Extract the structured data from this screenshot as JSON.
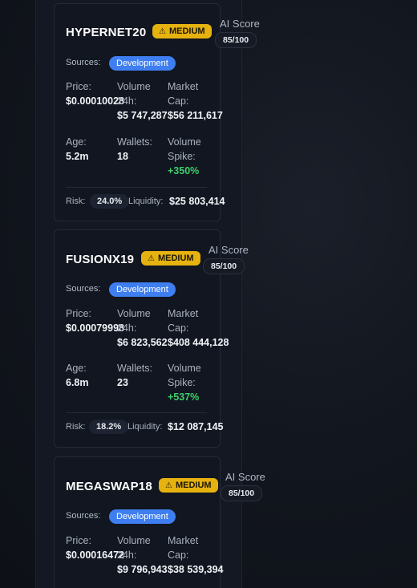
{
  "cards": [
    {
      "name": "HYPERNET20",
      "risk_level": "MEDIUM",
      "ai_label": "AI Score",
      "ai_score": "85/100",
      "sources_label": "Sources:",
      "source_tag": "Development",
      "price_label": "Price:",
      "price": "$0.00010028",
      "volume_label_1": "Volume",
      "volume_label_2": "24h:",
      "volume": "$5 747,287",
      "mcap_label_1": "Market",
      "mcap_label_2": "Cap:",
      "mcap": "$56 211,617",
      "age_label": "Age:",
      "age": "5.2m",
      "wallets_label": "Wallets:",
      "wallets": "18",
      "spike_label_1": "Volume",
      "spike_label_2": "Spike:",
      "spike": "+350%",
      "risk_label": "Risk:",
      "risk_pct": "24.0%",
      "liquidity_label": "Liquidity:",
      "liquidity": "$25 803,414"
    },
    {
      "name": "FUSIONX19",
      "risk_level": "MEDIUM",
      "ai_label": "AI Score",
      "ai_score": "85/100",
      "sources_label": "Sources:",
      "source_tag": "Development",
      "price_label": "Price:",
      "price": "$0.00079998",
      "volume_label_1": "Volume",
      "volume_label_2": "24h:",
      "volume": "$6 823,562",
      "mcap_label_1": "Market",
      "mcap_label_2": "Cap:",
      "mcap": "$408 444,128",
      "age_label": "Age:",
      "age": "6.8m",
      "wallets_label": "Wallets:",
      "wallets": "23",
      "spike_label_1": "Volume",
      "spike_label_2": "Spike:",
      "spike": "+537%",
      "risk_label": "Risk:",
      "risk_pct": "18.2%",
      "liquidity_label": "Liquidity:",
      "liquidity": "$12 087,145"
    },
    {
      "name": "MEGASWAP18",
      "risk_level": "MEDIUM",
      "ai_label": "AI Score",
      "ai_score": "85/100",
      "sources_label": "Sources:",
      "source_tag": "Development",
      "price_label": "Price:",
      "price": "$0.00016472",
      "volume_label_1": "Volume",
      "volume_label_2": "24h:",
      "volume": "$9 796,943",
      "mcap_label_1": "Market",
      "mcap_label_2": "Cap:",
      "mcap": "$38 539,394"
    }
  ],
  "icons": {
    "warning": "warning-icon"
  },
  "colors": {
    "badge_medium": "#e5b20f",
    "source_tag": "#3f7ef0",
    "positive": "#3fcf6a"
  }
}
